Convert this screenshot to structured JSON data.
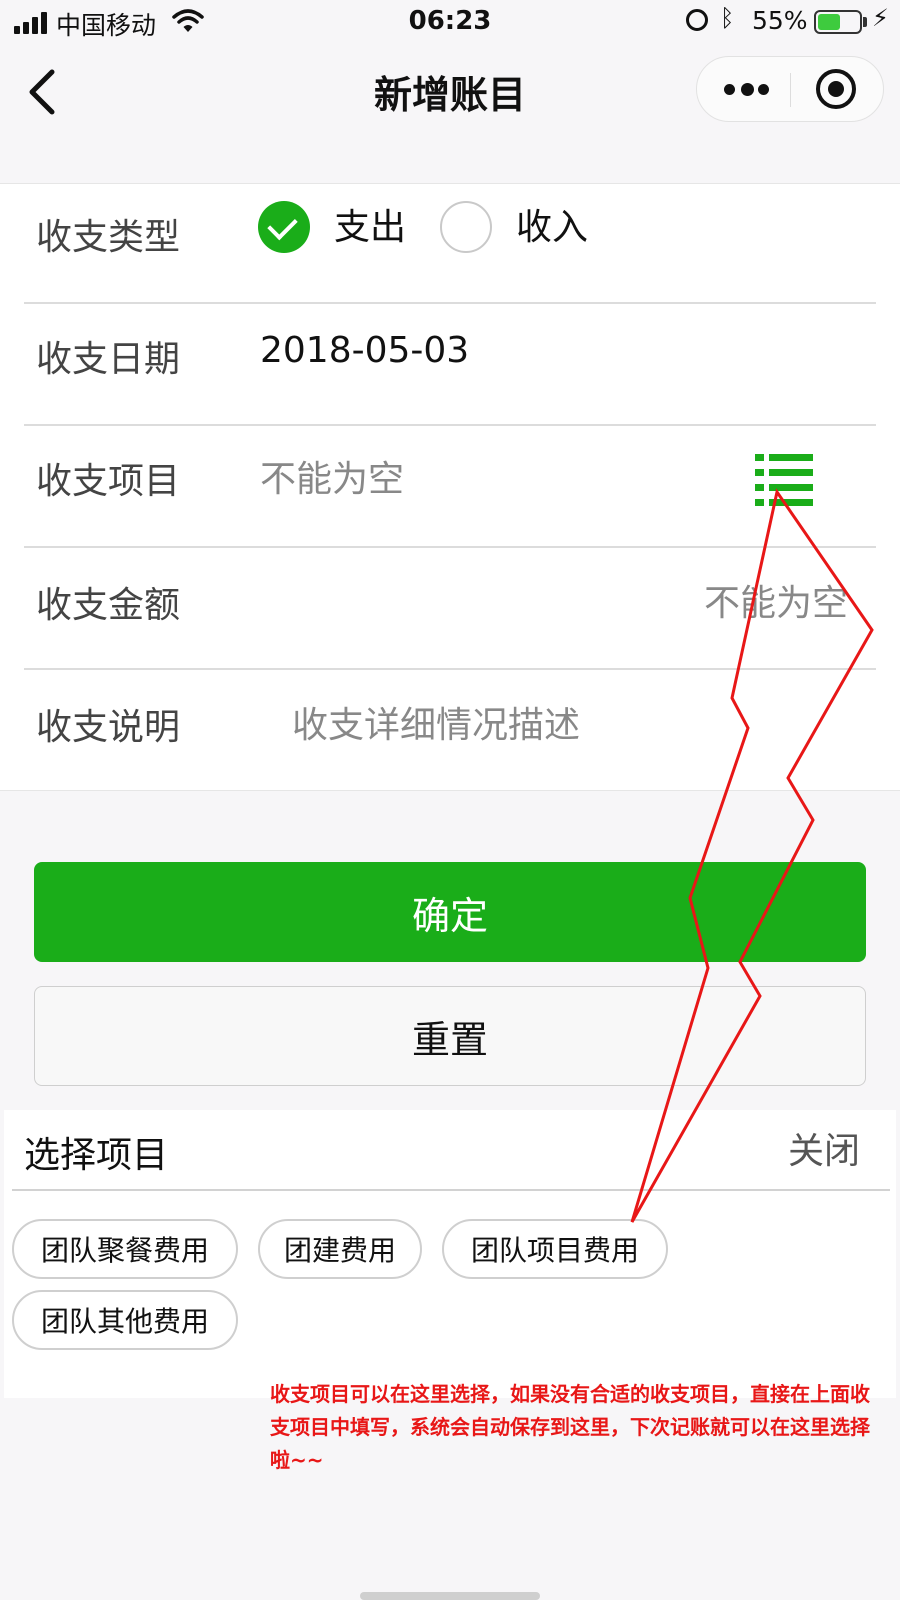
{
  "status_bar": {
    "carrier": "中国移动",
    "time": "06:23",
    "battery_percent": "55%",
    "battery_level": 0.55,
    "battery_color": "#3ecb3e"
  },
  "nav": {
    "title": "新增账目",
    "back_icon": "chevron-left-icon",
    "more_icon": "more-dots-icon",
    "close_icon": "target-close-icon"
  },
  "form": {
    "type": {
      "label": "收支类型",
      "options": [
        "支出",
        "收入"
      ],
      "selected": "支出"
    },
    "date": {
      "label": "收支日期",
      "value": "2018-05-03"
    },
    "item": {
      "label": "收支项目",
      "placeholder": "不能为空",
      "icon": "list-icon"
    },
    "amount": {
      "label": "收支金额",
      "placeholder": "不能为空"
    },
    "description": {
      "label": "收支说明",
      "placeholder": "收支详细情况描述"
    }
  },
  "buttons": {
    "confirm": "确定",
    "reset": "重置"
  },
  "picker": {
    "title": "选择项目",
    "close": "关闭",
    "chips": [
      "团队聚餐费用",
      "团建费用",
      "团队项目费用",
      "团队其他费用"
    ]
  },
  "annotation": "收支项目可以在这里选择，如果没有合适的收支项目，直接在上面收支项目中填写，系统会自动保存到这里，下次记账就可以在这里选择啦~~",
  "colors": {
    "primary_green": "#1aad19",
    "annotation_red": "#e81717",
    "page_background": "#f7f6f8"
  }
}
